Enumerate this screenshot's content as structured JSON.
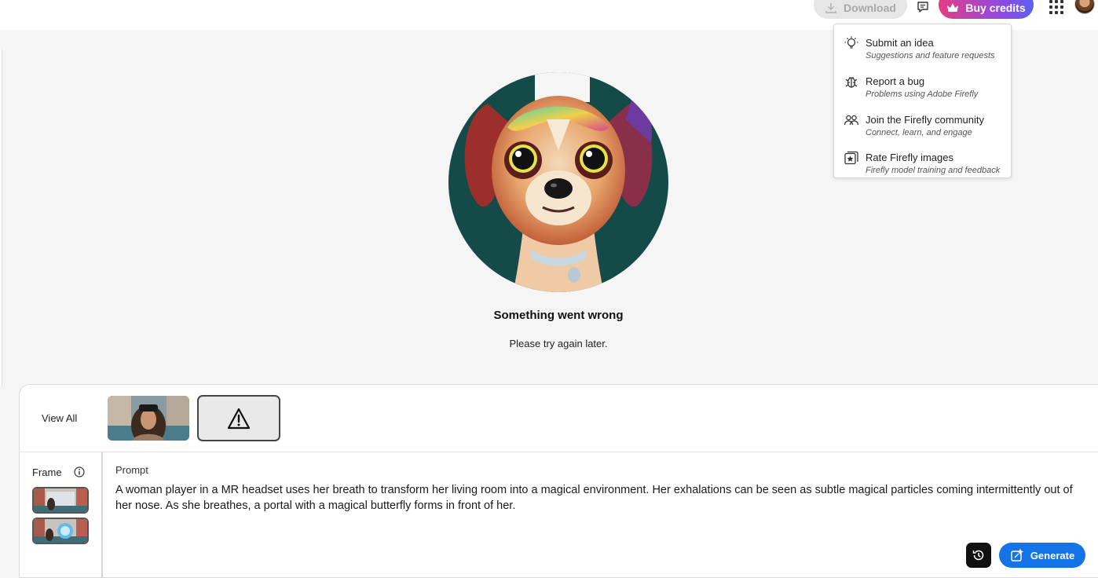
{
  "header": {
    "download_label": "Download",
    "buy_credits_label": "Buy credits"
  },
  "feedback_menu": {
    "items": [
      {
        "title": "Submit an idea",
        "subtitle": "Suggestions and feature requests",
        "icon": "lightbulb-icon"
      },
      {
        "title": "Report a bug",
        "subtitle": "Problems using Adobe Firefly",
        "icon": "bug-icon"
      },
      {
        "title": "Join the Firefly community",
        "subtitle": "Connect, learn, and engage",
        "icon": "community-icon"
      },
      {
        "title": "Rate Firefly images",
        "subtitle": "Firefly model training and feedback",
        "icon": "rate-images-icon"
      }
    ]
  },
  "error": {
    "title": "Something went wrong",
    "message": "Please try again later."
  },
  "gallery": {
    "view_all_label": "View All"
  },
  "frame": {
    "label": "Frame"
  },
  "prompt": {
    "label": "Prompt",
    "text": "A woman player in a MR headset uses her breath to transform her living room into a magical environment. Her exhalations can be seen as subtle magical particles coming intermittently out of her nose. As she breathes, a portal with a magical butterfly forms in front of her."
  },
  "actions": {
    "generate_label": "Generate"
  },
  "colors": {
    "accent": "#1473e6",
    "credits_gradient_start": "#e43d83",
    "credits_gradient_end": "#5b5fee"
  }
}
